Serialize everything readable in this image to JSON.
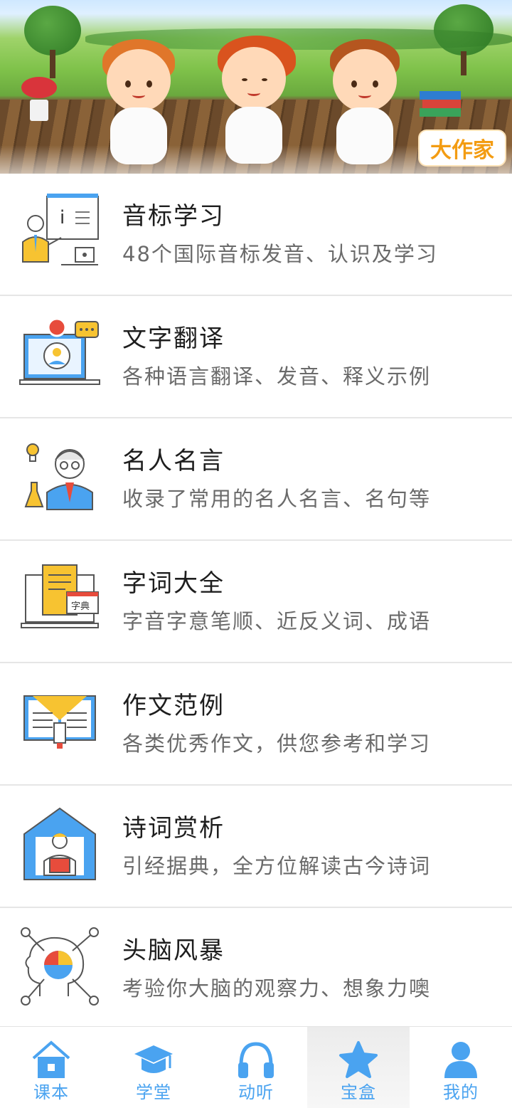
{
  "banner": {
    "badge": "大作家"
  },
  "items": [
    {
      "title": "音标学习",
      "subtitle": "48个国际音标发音、认识及学习",
      "icon": "teacher-board-icon"
    },
    {
      "title": "文字翻译",
      "subtitle": "各种语言翻译、发音、释义示例",
      "icon": "laptop-chat-icon"
    },
    {
      "title": "名人名言",
      "subtitle": "收录了常用的名人名言、名句等",
      "icon": "professor-icon"
    },
    {
      "title": "字词大全",
      "subtitle": "字音字意笔顺、近反义词、成语",
      "icon": "dictionary-icon"
    },
    {
      "title": "作文范例",
      "subtitle": "各类优秀作文，供您参考和学习",
      "icon": "open-book-icon"
    },
    {
      "title": "诗词赏析",
      "subtitle": "引经据典，全方位解读古今诗词",
      "icon": "reading-house-icon"
    },
    {
      "title": "头脑风暴",
      "subtitle": "考验你大脑的观察力、想象力噢",
      "icon": "brain-network-icon"
    }
  ],
  "tabs": [
    {
      "label": "课本",
      "icon": "home-icon"
    },
    {
      "label": "学堂",
      "icon": "graduation-cap-icon"
    },
    {
      "label": "动听",
      "icon": "headphones-icon"
    },
    {
      "label": "宝盒",
      "icon": "star-icon",
      "active": true
    },
    {
      "label": "我的",
      "icon": "person-icon"
    }
  ],
  "colors": {
    "accent": "#4aa3f0",
    "badge": "#f39c12",
    "icon_yellow": "#f7c331",
    "icon_blue": "#5aa9ec"
  }
}
